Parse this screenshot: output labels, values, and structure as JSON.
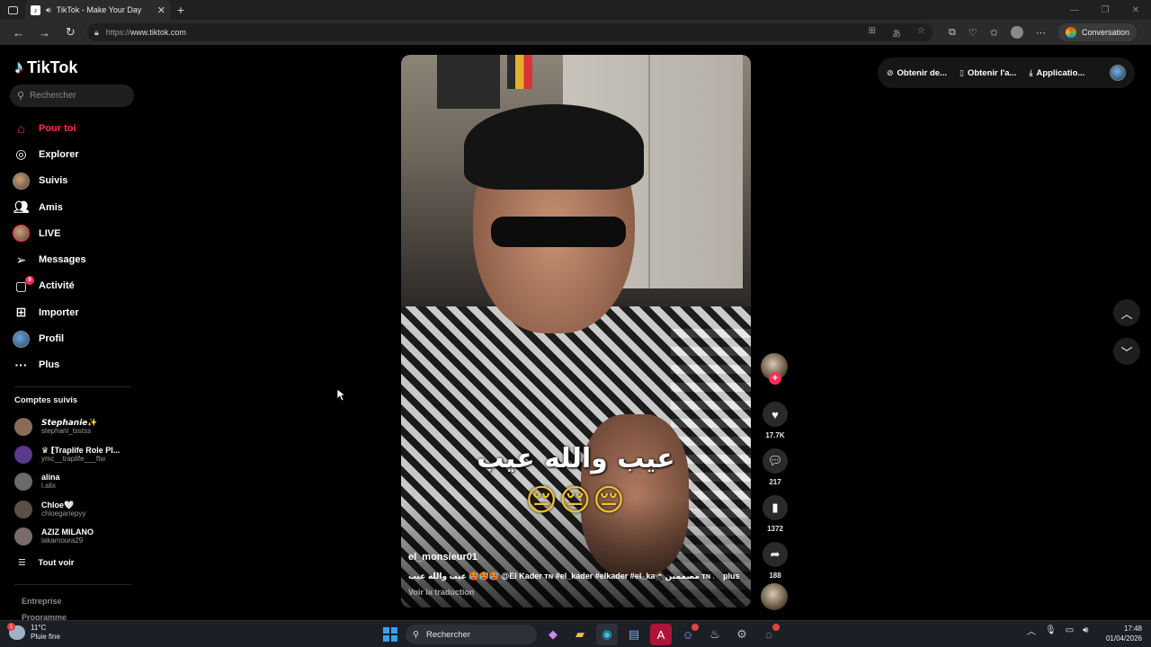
{
  "browser": {
    "tab_title": "TikTok - Make Your Day",
    "url_prefix": "https://",
    "url_domain": "www.tiktok.com",
    "conversation_label": "Conversation"
  },
  "app": {
    "brand": "TikTok",
    "search_placeholder": "Rechercher"
  },
  "sidebar": {
    "nav": [
      {
        "label": "Pour toi",
        "icon": "home-icon",
        "active": true
      },
      {
        "label": "Explorer",
        "icon": "compass-icon"
      },
      {
        "label": "Suivis",
        "icon": "following-avatar"
      },
      {
        "label": "Amis",
        "icon": "friends-icon"
      },
      {
        "label": "LIVE",
        "icon": "live-avatar"
      },
      {
        "label": "Messages",
        "icon": "send-icon"
      },
      {
        "label": "Activité",
        "icon": "activity-icon",
        "badge": "9"
      },
      {
        "label": "Importer",
        "icon": "upload-icon"
      },
      {
        "label": "Profil",
        "icon": "profile-avatar"
      },
      {
        "label": "Plus",
        "icon": "more-icon"
      }
    ],
    "followed_title": "Comptes suivis",
    "followed": [
      {
        "name": "𝙎𝙩𝙚𝙥𝙝𝙖𝙣𝙞𝙚✨",
        "handle": "stephani_tsstss",
        "color": "#8b6a5a"
      },
      {
        "name": "♛ ⁅Traplife Role Pl...",
        "handle": "ymc__traplife___ftw",
        "color": "#5a3a8a"
      },
      {
        "name": "alina",
        "handle": "l.alix",
        "color": "#6a6a6a"
      },
      {
        "name": "Chloe🤍",
        "handle": "chloegariepyy",
        "color": "#5a5048"
      },
      {
        "name": "AZIZ MILANO",
        "handle": "lakamoura29",
        "color": "#7a6a6a"
      }
    ],
    "see_all": "Tout voir",
    "footer": [
      "Entreprise",
      "Programme"
    ]
  },
  "video": {
    "caption_arabic": "عيب والله عيب",
    "caption_emoji": "😔😔😔",
    "author": "el_monsieur01",
    "description": "عيب والله عيب 🥵🥵🥵 @El Kader ᴛɴ #el_kader #elkader #el_ka🥷🏻مصممين ᴛɴ ...",
    "more": "plus",
    "translate": "Voir la traduction"
  },
  "actions": {
    "likes": "17.7K",
    "comments": "217",
    "saves": "1372",
    "shares": "188"
  },
  "topbar": {
    "items": [
      "Obtenir de...",
      "Obtenir l'a...",
      "Applicatio..."
    ]
  },
  "taskbar": {
    "temp": "11°C",
    "weather": "Pluie fine",
    "weather_badge": "1",
    "search": "Rechercher",
    "time": "17:48",
    "date": "01/04/2026"
  },
  "colors": {
    "accent": "#fe2c55",
    "background": "#000000"
  }
}
